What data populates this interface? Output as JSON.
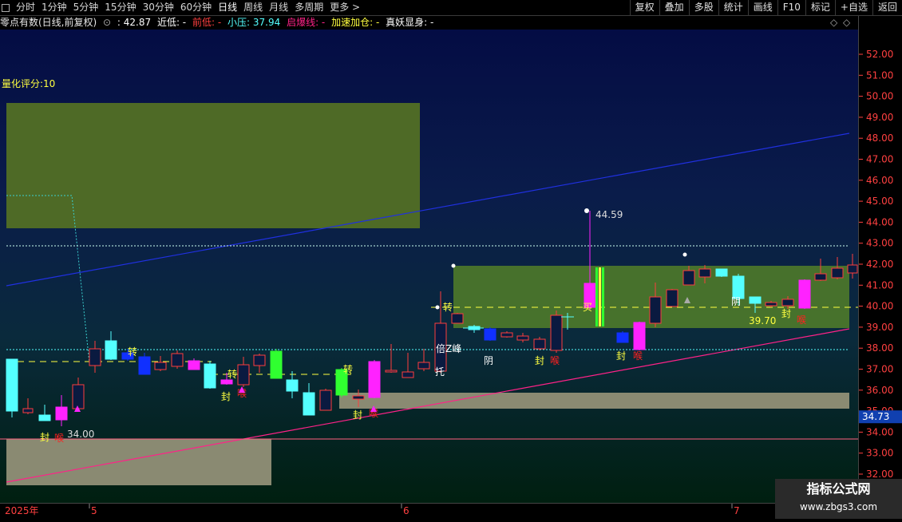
{
  "toolbar": {
    "left_items": [
      "分时",
      "1分钟",
      "5分钟",
      "15分钟",
      "30分钟",
      "60分钟",
      "日线",
      "周线",
      "月线",
      "多周期",
      "更多 >"
    ],
    "active_item": "日线",
    "right_items": [
      "复权",
      "叠加",
      "多股",
      "统计",
      "画线",
      "F10",
      "标记",
      "+自选",
      "返回"
    ]
  },
  "info_bar": {
    "title": "零点有数(日线,前复权)",
    "dropdown": "⊙",
    "value": ": 42.87",
    "near_low": "近低: -",
    "prev_low": "前低: -",
    "small_pressure": "小压: 37.94",
    "ignition": "启爆线: -",
    "accelerate": "加速加仓: -",
    "true_demon": "真妖显身: -",
    "right_icons": [
      "◇",
      "◇"
    ]
  },
  "score_label": "量化评分:10",
  "price_axis": {
    "ticks": [
      "52.00",
      "51.00",
      "50.00",
      "49.00",
      "48.00",
      "47.00",
      "46.00",
      "45.00",
      "44.00",
      "43.00",
      "42.00",
      "41.00",
      "40.00",
      "39.00",
      "38.00",
      "37.00",
      "36.00",
      "35.00",
      "34.00",
      "33.00",
      "32.00"
    ],
    "current_price": "34.73"
  },
  "date_axis": [
    "2025年",
    "5",
    "6",
    "7"
  ],
  "annotations": {
    "high_label": "44.59",
    "low_label": "34.00",
    "price_3970": "39.70",
    "zhuan": "转",
    "feng": "封",
    "hou": "喉",
    "yin": "阴",
    "tuo": "托",
    "ban": "倍Z峰",
    "mai": "买"
  },
  "colors": {
    "up": "#ff3d3d",
    "down": "#54ffff",
    "magenta": "#ff22ff",
    "green_box": "#4e7a2a",
    "gray_box": "#8a8a72",
    "blue_line": "#2030e0",
    "pink_line": "#ff2288"
  },
  "watermark": {
    "title": "指标公式网",
    "url": "www.zbgs3.com"
  }
}
